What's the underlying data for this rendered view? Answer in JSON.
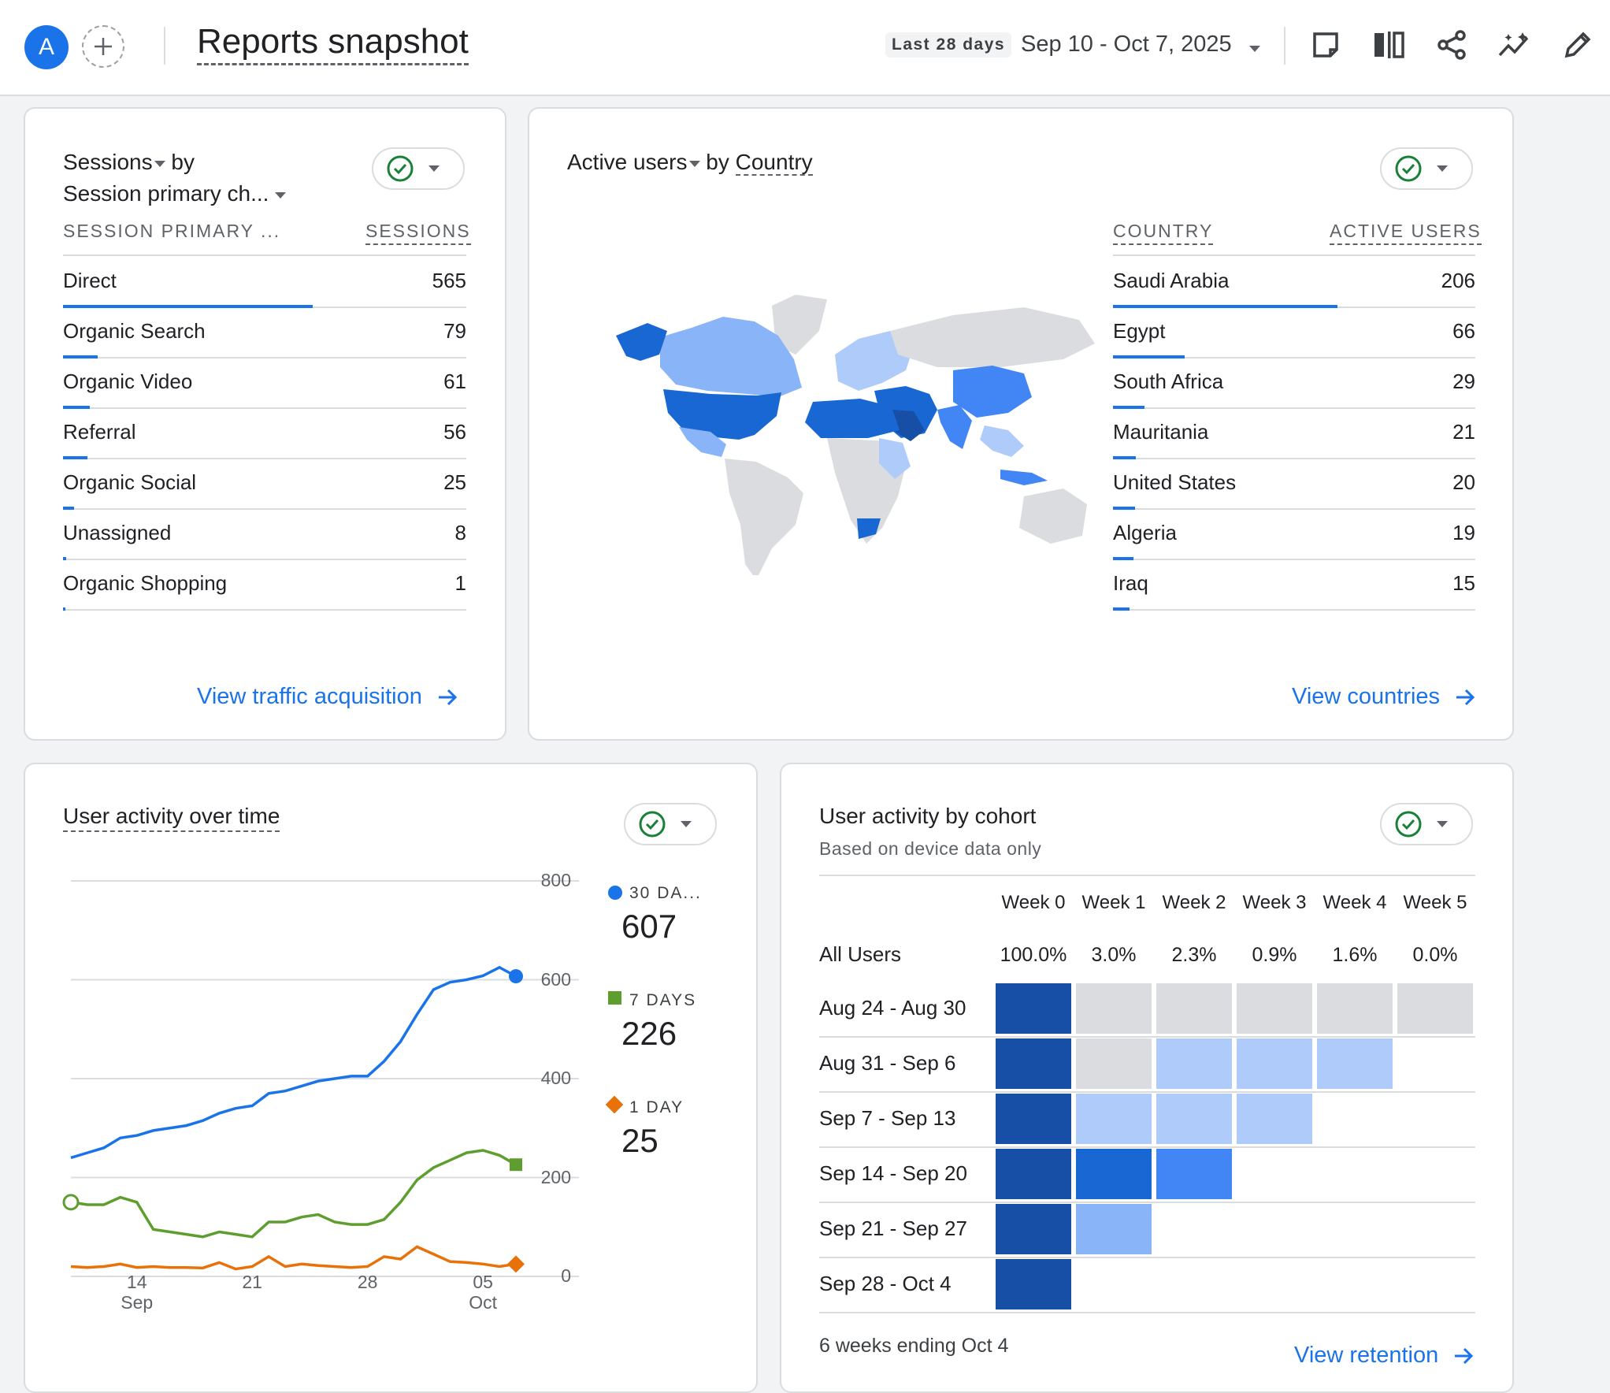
{
  "header": {
    "avatar_letter": "A",
    "title": "Reports snapshot",
    "range_chip": "Last 28 days",
    "range_text": "Sep 10 - Oct 7, 2025",
    "icons": [
      "add-comparison-icon",
      "compare-icon",
      "share-icon",
      "insights-icon",
      "edit-icon"
    ]
  },
  "sessions_card": {
    "metric": "Sessions",
    "by": "by",
    "dimension": "Session primary ch...",
    "col_dim": "SESSION PRIMARY ...",
    "col_metric": "SESSIONS",
    "rows": [
      {
        "label": "Direct",
        "value": "565",
        "ratio": 1.0
      },
      {
        "label": "Organic Search",
        "value": "79",
        "ratio": 0.14
      },
      {
        "label": "Organic Video",
        "value": "61",
        "ratio": 0.108
      },
      {
        "label": "Referral",
        "value": "56",
        "ratio": 0.099
      },
      {
        "label": "Organic Social",
        "value": "25",
        "ratio": 0.044
      },
      {
        "label": "Unassigned",
        "value": "8",
        "ratio": 0.014
      },
      {
        "label": "Organic Shopping",
        "value": "1",
        "ratio": 0.002
      }
    ],
    "link": "View traffic acquisition"
  },
  "country_card": {
    "metric": "Active users",
    "by": "by",
    "dimension": "Country",
    "col_dim": "COUNTRY",
    "col_metric": "ACTIVE USERS",
    "rows": [
      {
        "label": "Saudi Arabia",
        "value": "206",
        "ratio": 1.0
      },
      {
        "label": "Egypt",
        "value": "66",
        "ratio": 0.32
      },
      {
        "label": "South Africa",
        "value": "29",
        "ratio": 0.141
      },
      {
        "label": "Mauritania",
        "value": "21",
        "ratio": 0.102
      },
      {
        "label": "United States",
        "value": "20",
        "ratio": 0.097
      },
      {
        "label": "Algeria",
        "value": "19",
        "ratio": 0.092
      },
      {
        "label": "Iraq",
        "value": "15",
        "ratio": 0.073
      }
    ],
    "link": "View countries"
  },
  "activity_card": {
    "title": "User activity over time",
    "legend": [
      {
        "label": "30 DA...",
        "value": "607",
        "color": "#1a73e8"
      },
      {
        "label": "7 DAYS",
        "value": "226",
        "color": "#5e9e2e"
      },
      {
        "label": "1 DAY",
        "value": "25",
        "color": "#e8710a"
      }
    ],
    "y_ticks": [
      "800",
      "600",
      "400",
      "200",
      "0"
    ],
    "x_ticks": [
      {
        "day": "14",
        "month": "Sep"
      },
      {
        "day": "21",
        "month": ""
      },
      {
        "day": "28",
        "month": ""
      },
      {
        "day": "05",
        "month": "Oct"
      }
    ]
  },
  "chart_data": {
    "type": "line",
    "x": [
      "Sep 10",
      "Sep 11",
      "Sep 12",
      "Sep 13",
      "Sep 14",
      "Sep 15",
      "Sep 16",
      "Sep 17",
      "Sep 18",
      "Sep 19",
      "Sep 20",
      "Sep 21",
      "Sep 22",
      "Sep 23",
      "Sep 24",
      "Sep 25",
      "Sep 26",
      "Sep 27",
      "Sep 28",
      "Sep 29",
      "Sep 30",
      "Oct 1",
      "Oct 2",
      "Oct 3",
      "Oct 4",
      "Oct 5",
      "Oct 6",
      "Oct 7"
    ],
    "series": [
      {
        "name": "30 DA...",
        "values": [
          240,
          250,
          260,
          280,
          285,
          295,
          300,
          305,
          315,
          330,
          340,
          345,
          370,
          375,
          385,
          395,
          400,
          405,
          405,
          435,
          475,
          530,
          580,
          595,
          600,
          608,
          625,
          607
        ]
      },
      {
        "name": "7 DAYS",
        "values": [
          150,
          145,
          145,
          160,
          150,
          95,
          90,
          85,
          80,
          90,
          85,
          80,
          110,
          110,
          120,
          125,
          110,
          105,
          105,
          115,
          150,
          195,
          220,
          235,
          250,
          255,
          245,
          226
        ]
      },
      {
        "name": "1 DAY",
        "values": [
          20,
          18,
          20,
          25,
          18,
          20,
          18,
          18,
          17,
          28,
          15,
          20,
          40,
          20,
          25,
          22,
          20,
          18,
          20,
          40,
          35,
          60,
          45,
          30,
          28,
          25,
          20,
          25
        ]
      }
    ],
    "ylim": [
      0,
      800
    ]
  },
  "cohort_card": {
    "title": "User activity by cohort",
    "subtitle": "Based on device data only",
    "weeks": [
      "Week 0",
      "Week 1",
      "Week 2",
      "Week 3",
      "Week 4",
      "Week 5"
    ],
    "all_users_label": "All Users",
    "all_users": [
      "100.0%",
      "3.0%",
      "2.3%",
      "0.9%",
      "1.6%",
      "0.0%"
    ],
    "rows": [
      {
        "label": "Aug 24 - Aug 30",
        "cells": [
          "#174ea6",
          "#dadce0",
          "#dadce0",
          "#dadce0",
          "#dadce0",
          "#dadce0"
        ]
      },
      {
        "label": "Aug 31 - Sep 6",
        "cells": [
          "#174ea6",
          "#dadce0",
          "#aecbfa",
          "#aecbfa",
          "#aecbfa"
        ]
      },
      {
        "label": "Sep 7 - Sep 13",
        "cells": [
          "#174ea6",
          "#aecbfa",
          "#aecbfa",
          "#aecbfa"
        ]
      },
      {
        "label": "Sep 14 - Sep 20",
        "cells": [
          "#174ea6",
          "#1967d2",
          "#4285f4"
        ]
      },
      {
        "label": "Sep 21 - Sep 27",
        "cells": [
          "#174ea6",
          "#8ab4f8"
        ]
      },
      {
        "label": "Sep 28 - Oct 4",
        "cells": [
          "#174ea6"
        ]
      }
    ],
    "footer": "6 weeks ending Oct 4",
    "link": "View retention"
  },
  "colors": {
    "accent": "#1a73e8",
    "check": "#188038"
  }
}
